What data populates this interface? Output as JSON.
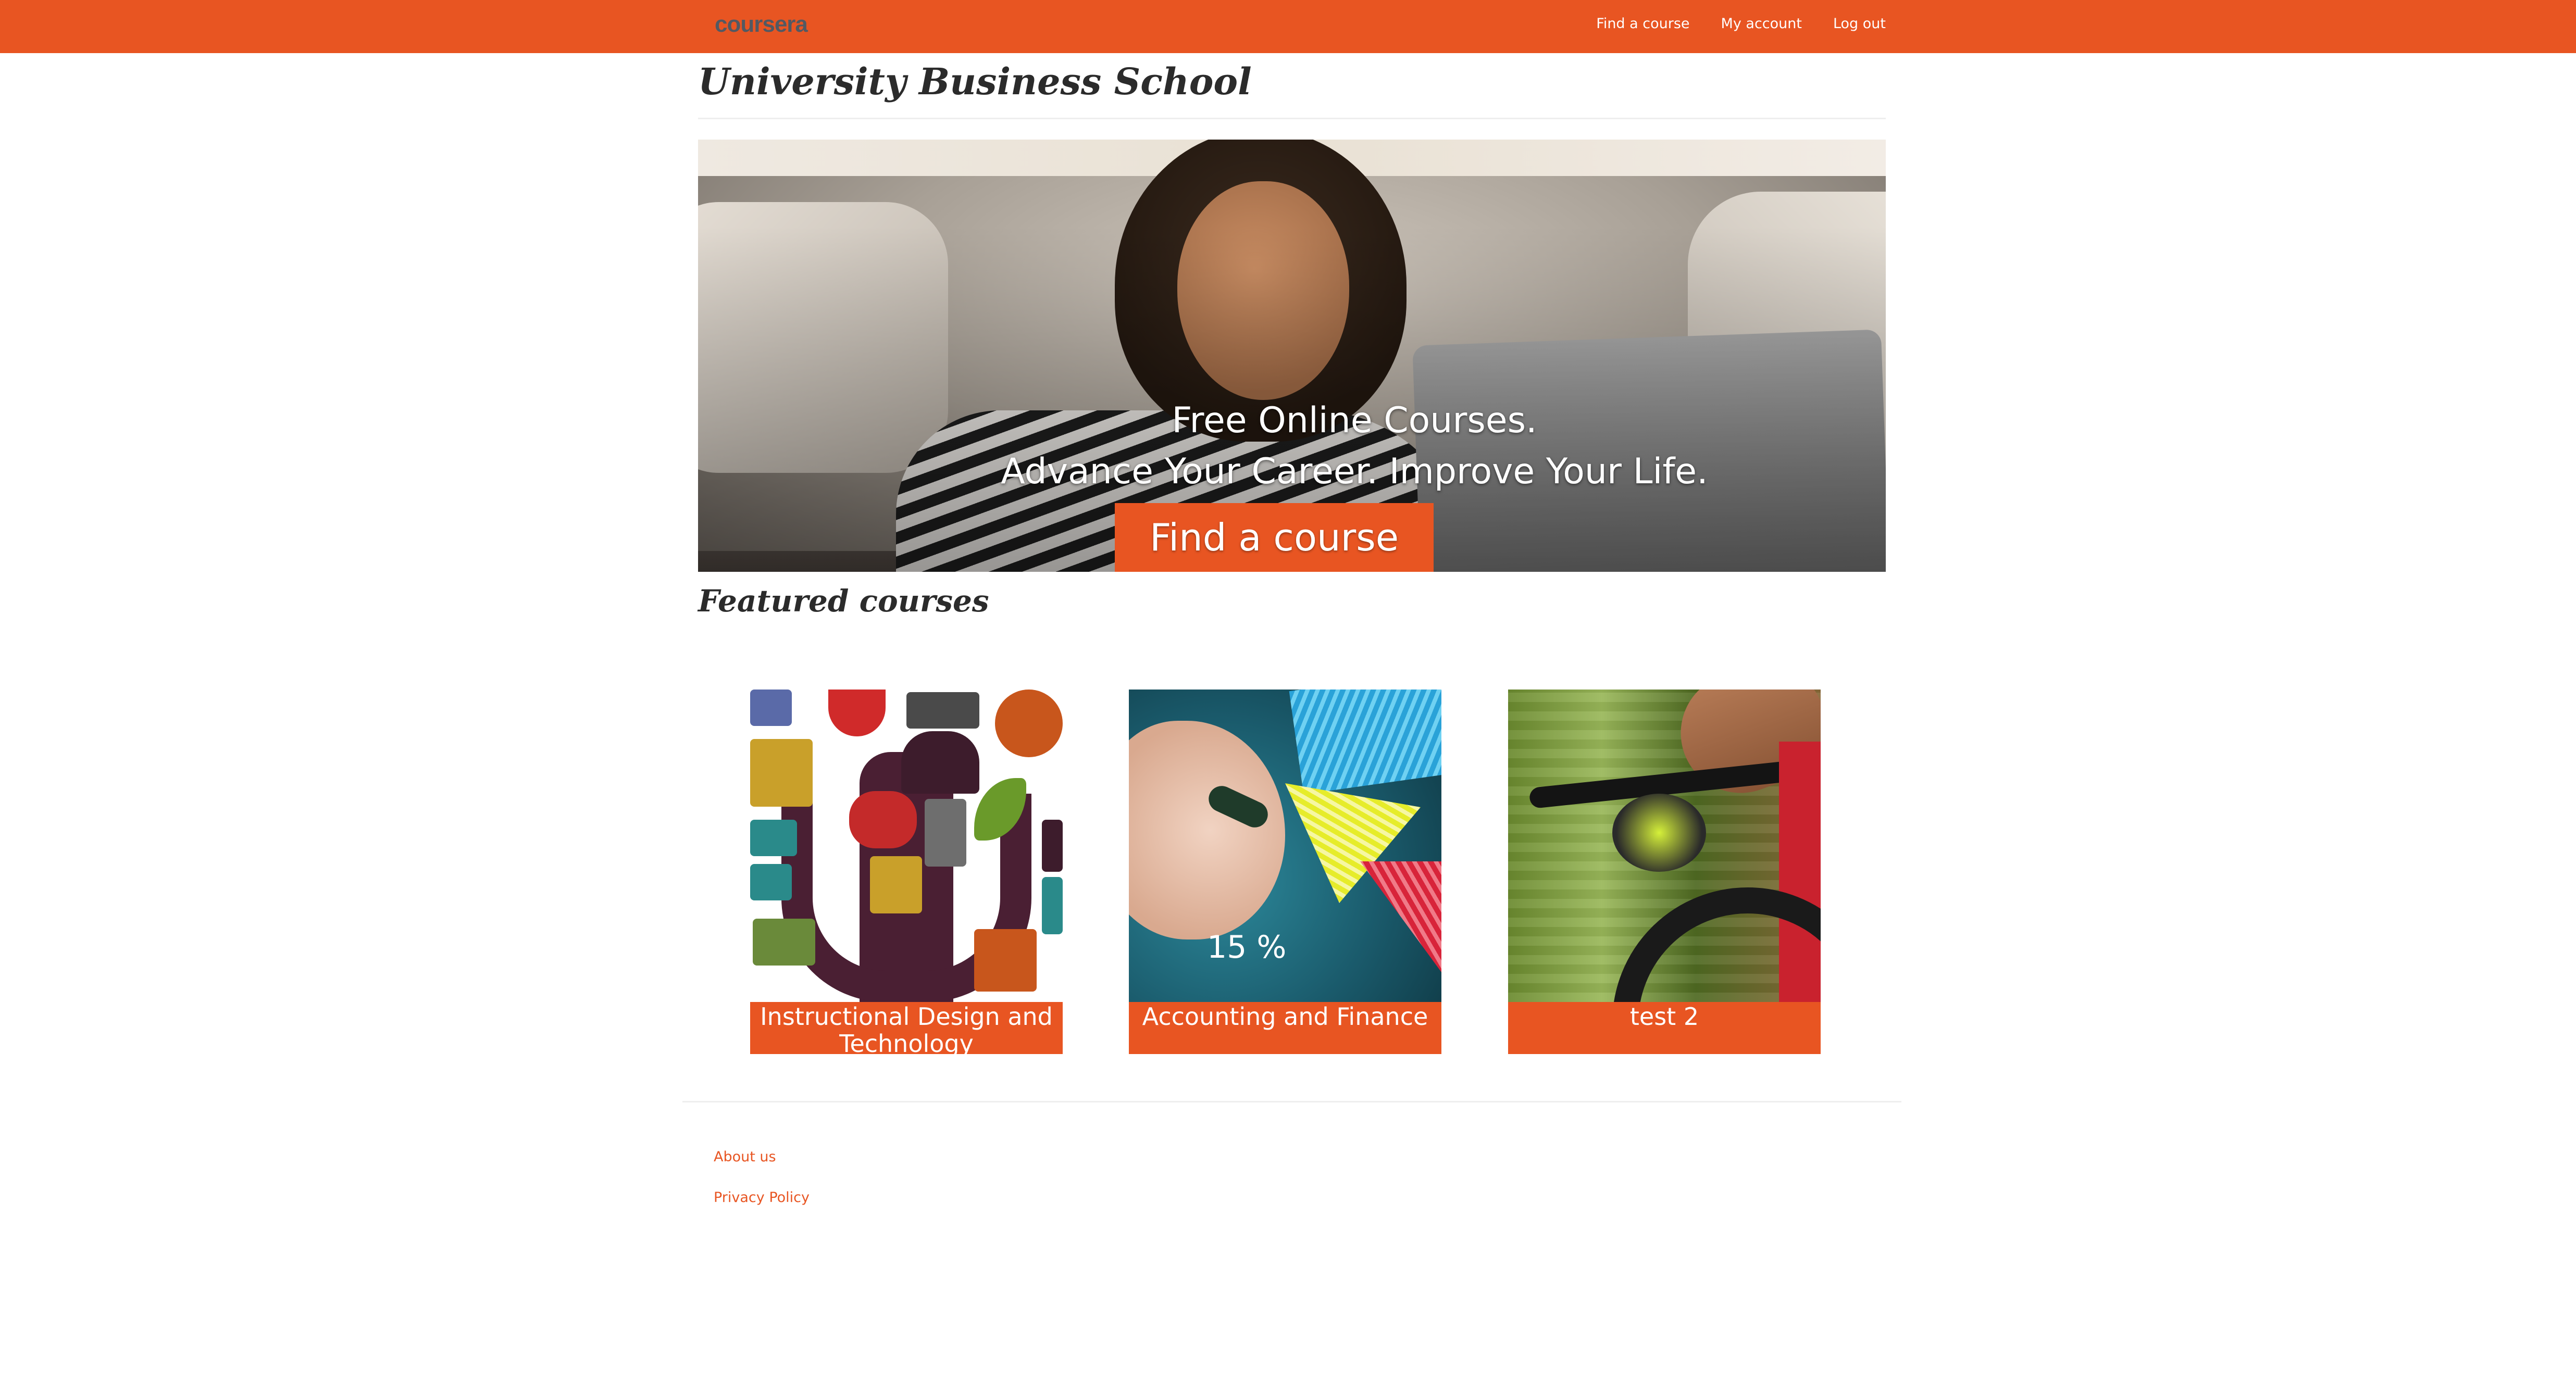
{
  "header": {
    "logo_text": "coursera",
    "nav": [
      {
        "label": "Find a course"
      },
      {
        "label": "My account"
      },
      {
        "label": "Log out"
      }
    ]
  },
  "page": {
    "title": "University Business School"
  },
  "hero": {
    "line1": "Free Online Courses.",
    "line2": "Advance Your Career. Improve Your Life.",
    "cta_label": "Find a course"
  },
  "featured": {
    "title": "Featured courses",
    "courses": [
      {
        "title": "Instructional Design and Technology"
      },
      {
        "title": "Accounting and Finance",
        "image_text": "15 %"
      },
      {
        "title": "test 2"
      }
    ]
  },
  "footer": {
    "links": [
      {
        "label": "About us"
      },
      {
        "label": "Privacy Policy"
      }
    ]
  },
  "colors": {
    "accent": "#e85522",
    "text_dark": "#2b2b2b",
    "rule": "#eeeeee"
  }
}
